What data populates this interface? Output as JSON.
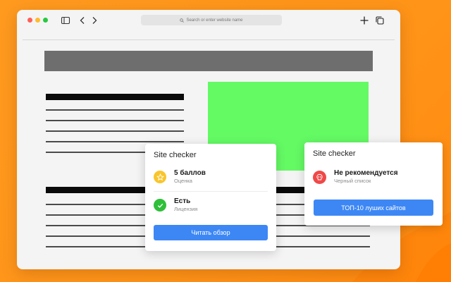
{
  "colors": {
    "background": "#ff9418",
    "accent_button": "#3d87f5",
    "placeholder_green": "#64fa64",
    "star_badge": "#f9c52b",
    "check_badge": "#2fbf3a",
    "warning_badge": "#f04848"
  },
  "browser": {
    "address_placeholder": "Search or enter website name",
    "icons": [
      "sidebar-icon",
      "back-icon",
      "forward-icon",
      "search-icon",
      "new-tab-icon",
      "tabs-icon"
    ]
  },
  "card_left": {
    "title": "Site checker",
    "rows": [
      {
        "icon": "star-icon",
        "main": "5 баллов",
        "sub": "Оценка"
      },
      {
        "icon": "check-icon",
        "main": "Есть",
        "sub": "Лицензия"
      }
    ],
    "button_label": "Читать обзор"
  },
  "card_right": {
    "title": "Site checker",
    "rows": [
      {
        "icon": "skull-icon",
        "main": "Не рекомендуется",
        "sub": "Черный список"
      }
    ],
    "button_label": "ТОП-10 луших сайтов"
  }
}
